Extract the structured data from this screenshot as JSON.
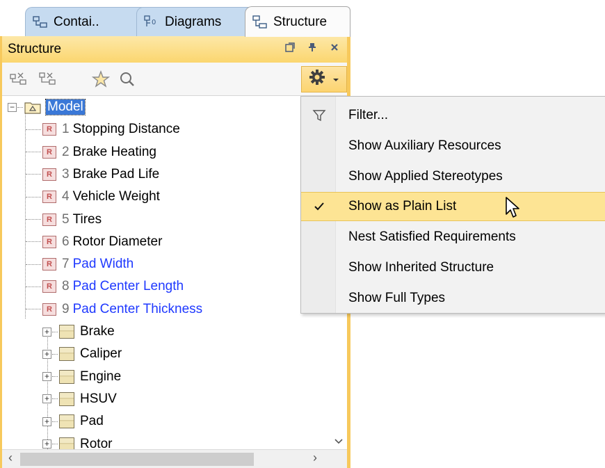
{
  "tabs": [
    {
      "label": "Contai..",
      "icon": "containment-icon"
    },
    {
      "label": "Diagrams",
      "icon": "diagrams-icon"
    },
    {
      "label": "Structure",
      "icon": "structure-icon",
      "active": true
    }
  ],
  "panel": {
    "title": "Structure",
    "title_controls": [
      "restore-icon",
      "pin-icon",
      "close-icon"
    ]
  },
  "toolbar": {
    "buttons": [
      "expand-all-icon",
      "collapse-all-icon",
      "star-icon",
      "search-icon"
    ],
    "options_icon": "gear-icon"
  },
  "tree": {
    "root": "Model",
    "requirements": [
      {
        "num": "1",
        "name": "Stopping Distance",
        "linked": false
      },
      {
        "num": "2",
        "name": "Brake Heating",
        "linked": false
      },
      {
        "num": "3",
        "name": "Brake Pad Life",
        "linked": false
      },
      {
        "num": "4",
        "name": "Vehicle Weight",
        "linked": false
      },
      {
        "num": "5",
        "name": "Tires",
        "linked": false
      },
      {
        "num": "6",
        "name": "Rotor Diameter",
        "linked": false
      },
      {
        "num": "7",
        "name": "Pad Width",
        "linked": true
      },
      {
        "num": "8",
        "name": "Pad Center Length",
        "linked": true
      },
      {
        "num": "9",
        "name": "Pad Center Thickness",
        "linked": true
      }
    ],
    "req_icon_letter": "R",
    "blocks": [
      "Brake",
      "Caliper",
      "Engine",
      "HSUV",
      "Pad",
      "Rotor"
    ]
  },
  "menu": {
    "items": [
      {
        "label": "Filter...",
        "gutter": "filter-icon"
      },
      {
        "label": "Show Auxiliary Resources"
      },
      {
        "label": "Show Applied Stereotypes"
      },
      {
        "label": "Show as Plain List",
        "checked": true,
        "highlighted": true
      },
      {
        "label": "Nest Satisfied Requirements"
      },
      {
        "label": "Show Inherited Structure"
      },
      {
        "label": "Show Full Types"
      }
    ]
  },
  "colors": {
    "tab_inactive": "#c6dbf0",
    "panel_accent": "#f7c95c",
    "menu_highlight": "#fde494",
    "link": "#1f39ff",
    "selection": "#3a78d7"
  }
}
